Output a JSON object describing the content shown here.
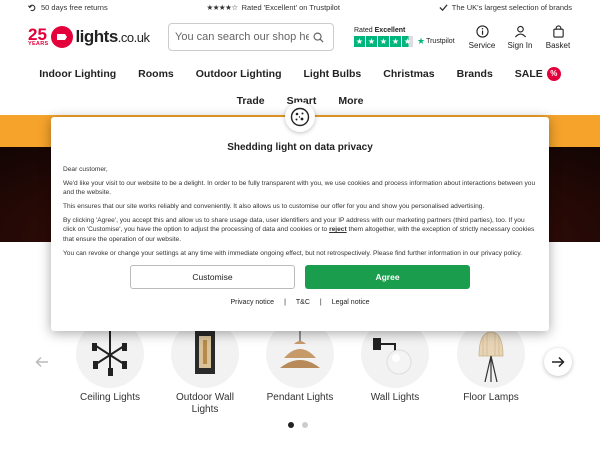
{
  "topbar": {
    "returns": "50 days free returns",
    "rating": "Rated 'Excellent' on Trustpilot",
    "selection": "The UK's largest selection of brands"
  },
  "header": {
    "logo_years_num": "25",
    "logo_years_label": "YEARS",
    "logo_name": "lights",
    "logo_suffix": ".co.uk",
    "search_placeholder": "You can search our shop here",
    "trust_rated": "Rated",
    "trust_excellent": "Excellent",
    "trustpilot_label": "Trustpilot",
    "service": "Service",
    "signin": "Sign In",
    "basket": "Basket"
  },
  "nav": [
    "Indoor Lighting",
    "Rooms",
    "Outdoor Lighting",
    "Light Bulbs",
    "Christmas",
    "Brands",
    "SALE",
    "Trade",
    "Smart",
    "More"
  ],
  "sale_badge": "%",
  "modal": {
    "title": "Shedding light on data privacy",
    "greeting": "Dear customer,",
    "p1": "We'd like your visit to our website to be a delight. In order to be fully transparent with you, we use cookies and process information about interactions between you and the website.",
    "p2": "This ensures that our site works reliably and conveniently. It also allows us to customise our offer for you and show you personalised advertising.",
    "p3a": "By clicking 'Agree', you accept this and allow us to share usage data, user identifiers and your IP address with our marketing partners (third parties), too. If you click on 'Customise', you have the option to adjust the processing of data and cookies or to ",
    "p3_reject": "reject",
    "p3b": " them altogether, with the exception of strictly necessary cookies that ensure the operation of our website.",
    "p4": "You can revoke or change your settings at any time with immediate ongoing effect, but not retrospectively. Please find further information in our privacy policy.",
    "customise": "Customise",
    "agree": "Agree",
    "privacy": "Privacy notice",
    "tc": "T&C",
    "legal": "Legal notice"
  },
  "categories": [
    {
      "label": "Ceiling Lights",
      "icon": "ceiling-light-icon"
    },
    {
      "label": "Outdoor Wall Lights",
      "icon": "outdoor-wall-light-icon"
    },
    {
      "label": "Pendant Lights",
      "icon": "pendant-light-icon"
    },
    {
      "label": "Wall Lights",
      "icon": "wall-light-icon"
    },
    {
      "label": "Floor Lamps",
      "icon": "floor-lamp-icon"
    }
  ],
  "colors": {
    "brand_red": "#e4003a",
    "agree_green": "#1a9e4d",
    "trustpilot_green": "#00b67a",
    "banner_orange": "#f5a32b"
  }
}
